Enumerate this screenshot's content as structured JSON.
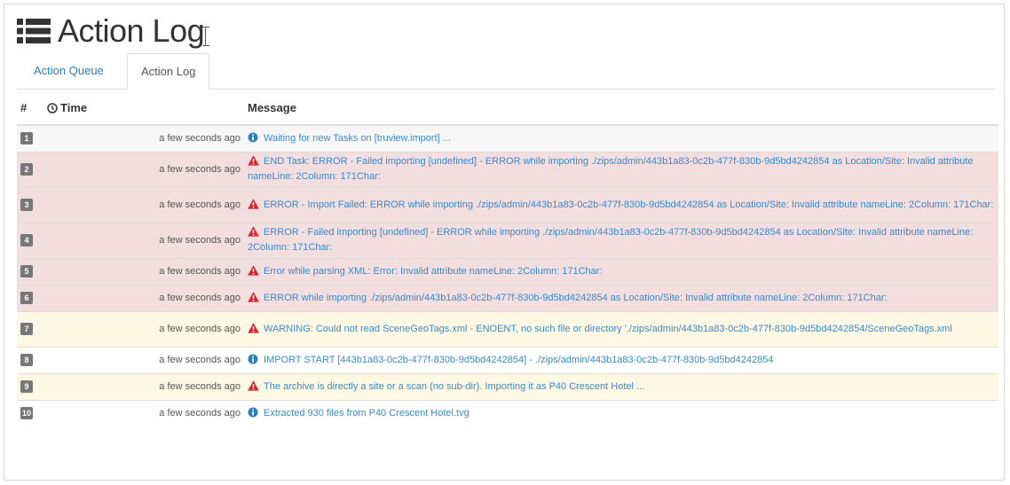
{
  "header": {
    "title": "Action Log",
    "icon": "list-icon"
  },
  "tabs": [
    {
      "label": "Action Queue",
      "active": false
    },
    {
      "label": "Action Log",
      "active": true
    }
  ],
  "table": {
    "columns": {
      "num": "#",
      "time": "Time",
      "message": "Message"
    },
    "rows": [
      {
        "num": "1",
        "time": "a few seconds ago",
        "level": "info",
        "message": "Waiting for new Tasks on [truview.import] ..."
      },
      {
        "num": "2",
        "time": "a few seconds ago",
        "level": "error",
        "message": "END Task: ERROR - Failed importing [undefined] - ERROR while importing ./zips/admin/443b1a83-0c2b-477f-830b-9d5bd4242854 as Location/Site: Invalid attribute nameLine: 2Column: 171Char:"
      },
      {
        "num": "3",
        "time": "a few seconds ago",
        "level": "error",
        "message": "ERROR - Import Failed: ERROR while importing ./zips/admin/443b1a83-0c2b-477f-830b-9d5bd4242854 as Location/Site: Invalid attribute nameLine: 2Column: 171Char:"
      },
      {
        "num": "4",
        "time": "a few seconds ago",
        "level": "error",
        "message": "ERROR - Failed importing [undefined] - ERROR while importing ./zips/admin/443b1a83-0c2b-477f-830b-9d5bd4242854 as Location/Site: Invalid attribute nameLine: 2Column: 171Char:"
      },
      {
        "num": "5",
        "time": "a few seconds ago",
        "level": "error",
        "message": "Error while parsing XML: Error: Invalid attribute nameLine: 2Column: 171Char:"
      },
      {
        "num": "6",
        "time": "a few seconds ago",
        "level": "error",
        "message": "ERROR while importing ./zips/admin/443b1a83-0c2b-477f-830b-9d5bd4242854 as Location/Site: Invalid attribute nameLine: 2Column: 171Char:"
      },
      {
        "num": "7",
        "time": "a few seconds ago",
        "level": "warning",
        "message": "WARNING: Could not read SceneGeoTags.xml - ENOENT, no such file or directory './zips/admin/443b1a83-0c2b-477f-830b-9d5bd4242854/SceneGeoTags.xml"
      },
      {
        "num": "8",
        "time": "a few seconds ago",
        "level": "info",
        "message": "IMPORT START [443b1a83-0c2b-477f-830b-9d5bd4242854] - ./zips/admin/443b1a83-0c2b-477f-830b-9d5bd4242854"
      },
      {
        "num": "9",
        "time": "a few seconds ago",
        "level": "warning",
        "message": "The archive is directly a site or a scan (no sub-dir). Importing it as P40 Crescent Hotel ..."
      },
      {
        "num": "10",
        "time": "a few seconds ago",
        "level": "info",
        "message": "Extracted 930 files from P40 Crescent Hotel.tvg"
      }
    ]
  },
  "colors": {
    "link": "#3a8acd",
    "error_row": "#f2dede",
    "warning_row": "#fcf8e3",
    "error_icon": "#d9242b",
    "info_icon": "#2a7fbf"
  }
}
